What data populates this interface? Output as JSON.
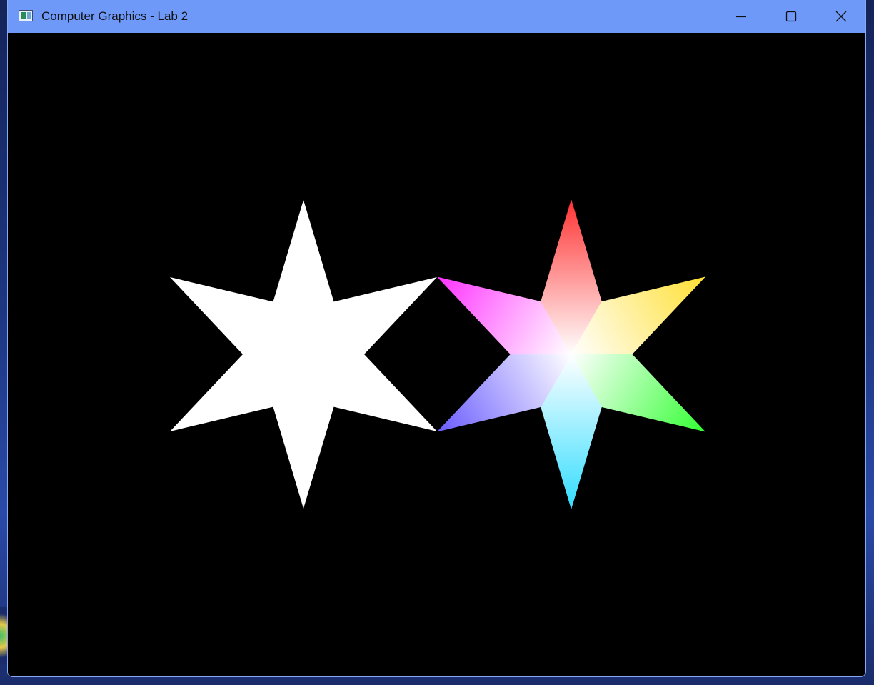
{
  "window": {
    "title": "Computer Graphics - Lab 2",
    "icons": {
      "app": "app-window-icon",
      "minimize": "minimize-icon",
      "maximize": "maximize-icon",
      "close": "close-icon"
    },
    "colors": {
      "titlebar": "#6e99f9",
      "canvas": "#000000",
      "border": "#8aa8f5"
    }
  },
  "canvas": {
    "shapes": [
      {
        "name": "white-star",
        "kind": "six-pointed-star",
        "fill": "#ffffff"
      },
      {
        "name": "gradient-star",
        "kind": "six-pointed-star",
        "center_color": "#ffffff",
        "tip_colors": [
          "#ff3333",
          "#ffe033",
          "#33ff33",
          "#33ddff",
          "#6a5cff",
          "#ff33ff"
        ]
      }
    ]
  }
}
